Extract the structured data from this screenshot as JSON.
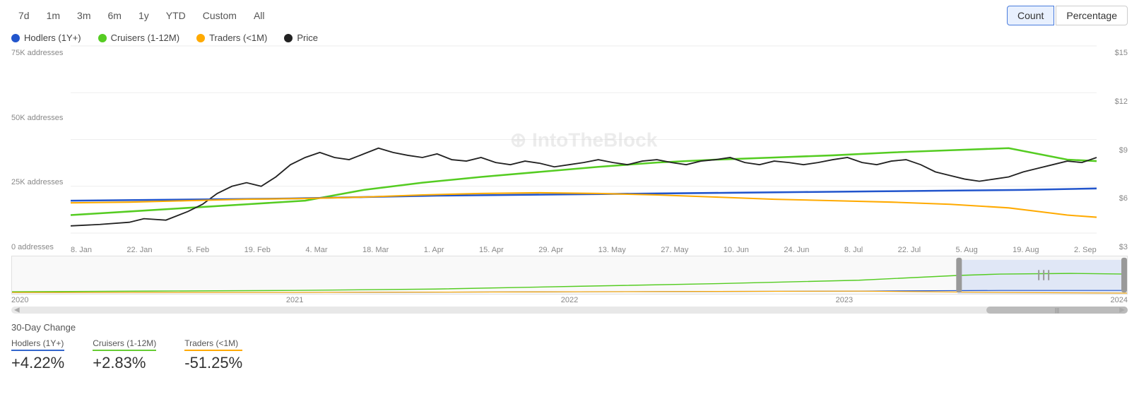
{
  "timeButtons": [
    {
      "label": "7d",
      "id": "7d"
    },
    {
      "label": "1m",
      "id": "1m"
    },
    {
      "label": "3m",
      "id": "3m"
    },
    {
      "label": "6m",
      "id": "6m"
    },
    {
      "label": "1y",
      "id": "1y"
    },
    {
      "label": "YTD",
      "id": "ytd"
    },
    {
      "label": "Custom",
      "id": "custom"
    },
    {
      "label": "All",
      "id": "all"
    }
  ],
  "viewToggle": {
    "count": "Count",
    "percentage": "Percentage"
  },
  "legend": [
    {
      "label": "Hodlers (1Y+)",
      "color": "#2255cc",
      "type": "dot"
    },
    {
      "label": "Cruisers (1-12M)",
      "color": "#55cc22",
      "type": "dot"
    },
    {
      "label": "Traders (<1M)",
      "color": "#ffaa00",
      "type": "dot"
    },
    {
      "label": "Price",
      "color": "#222222",
      "type": "dot"
    }
  ],
  "yAxisLeft": [
    "75K addresses",
    "50K addresses",
    "25K addresses",
    "0 addresses"
  ],
  "yAxisRight": [
    "$15",
    "$12",
    "$9",
    "$6",
    "$3"
  ],
  "xAxisLabels": [
    "8. Jan",
    "22. Jan",
    "5. Feb",
    "19. Feb",
    "4. Mar",
    "18. Mar",
    "1. Apr",
    "15. Apr",
    "29. Apr",
    "13. May",
    "27. May",
    "10. Jun",
    "24. Jun",
    "8. Jul",
    "22. Jul",
    "5. Aug",
    "19. Aug",
    "2. Sep"
  ],
  "miniYearLabels": [
    "2020",
    "2021",
    "2022",
    "2023",
    "2024"
  ],
  "watermark": "IntoTheBlock",
  "bottomSection": {
    "title": "30-Day Change",
    "items": [
      {
        "label": "Hodlers (1Y+)",
        "value": "+4.22%",
        "class": "hodlers"
      },
      {
        "label": "Cruisers (1-12M)",
        "value": "+2.83%",
        "class": "cruisers"
      },
      {
        "label": "Traders (<1M)",
        "value": "-51.25%",
        "class": "traders"
      }
    ]
  }
}
